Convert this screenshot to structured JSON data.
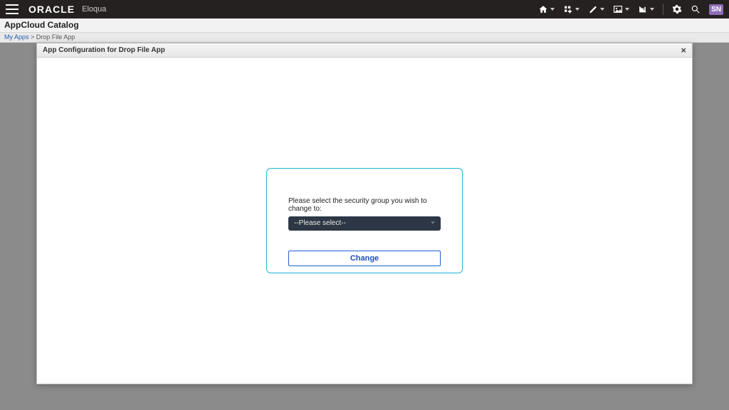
{
  "topbar": {
    "brand": "ORACLE",
    "product": "Eloqua",
    "user_initials": "SN"
  },
  "page": {
    "title": "AppCloud Catalog",
    "breadcrumb_root": "My Apps",
    "breadcrumb_sep": " > ",
    "breadcrumb_current": "Drop File App"
  },
  "modal": {
    "title": "App Configuration for Drop File App",
    "close_glyph": "×"
  },
  "form": {
    "prompt": "Please select the security group you wish to change to:",
    "select_placeholder": "--Please select--",
    "change_button": "Change"
  }
}
